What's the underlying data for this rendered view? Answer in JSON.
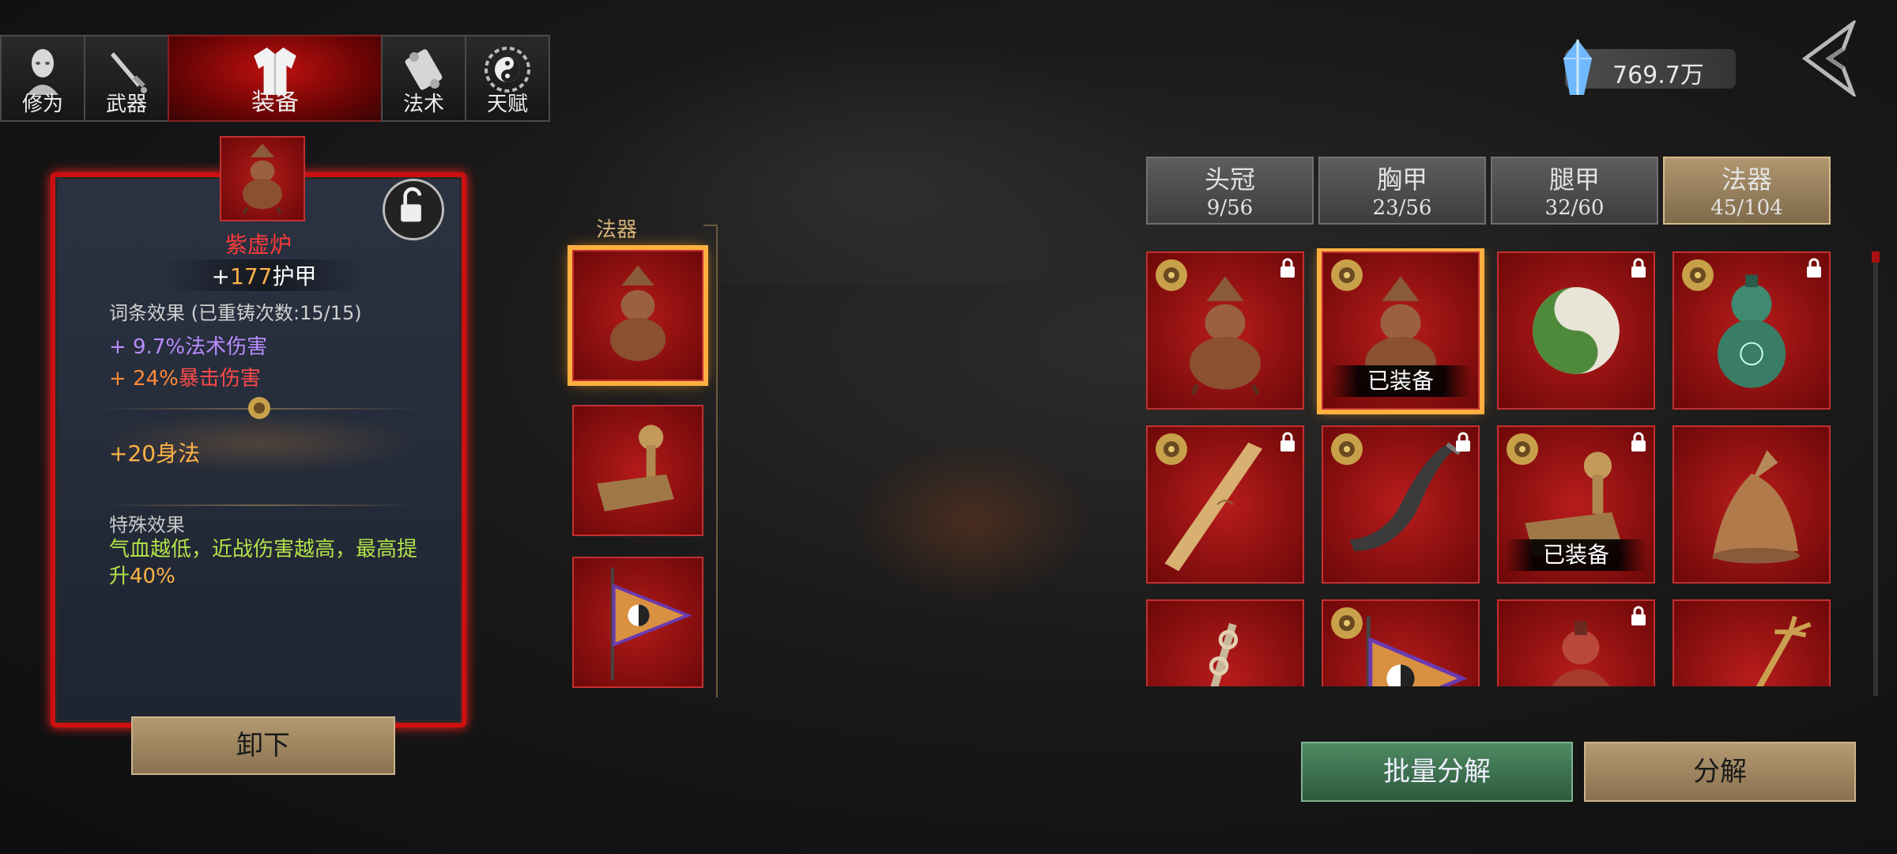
{
  "top_tabs": [
    {
      "label": "修为",
      "icon": "monk-head-icon",
      "active": false
    },
    {
      "label": "武器",
      "icon": "sword-icon",
      "active": false
    },
    {
      "label": "装备",
      "icon": "robe-icon",
      "active": true
    },
    {
      "label": "法术",
      "icon": "scroll-icon",
      "active": false
    },
    {
      "label": "天赋",
      "icon": "yin-yang-icon",
      "active": false
    }
  ],
  "currency": {
    "value": "769.7万",
    "icon": "spirit-crystal-icon"
  },
  "detail": {
    "name": "紫虚炉",
    "armor_prefix": "+",
    "armor_value": "177",
    "armor_label": "护甲",
    "affix_title": "词条效果",
    "reforge_note": "(已重铸次数:15/15)",
    "affix_1_value": "+ 9.7%",
    "affix_1_label": "法术伤害",
    "affix_2_value": "+ 24%",
    "affix_2_label": "暴击伤害",
    "bonus_prefix": "+",
    "bonus_value": "20",
    "bonus_label": "身法",
    "special_title": "特殊效果",
    "special_text_1": "气血越低，近战伤害越高，最高提升",
    "special_value": "40%",
    "unequip_label": "卸下"
  },
  "slot_column": {
    "heading": "法器",
    "slots": [
      {
        "item": "gourd-censer-icon",
        "selected": true
      },
      {
        "item": "seal-stamp-icon",
        "selected": false
      },
      {
        "item": "bagua-banner-icon",
        "selected": false
      }
    ]
  },
  "categories": [
    {
      "title": "头冠",
      "count": "9/56",
      "active": false
    },
    {
      "title": "胸甲",
      "count": "23/56",
      "active": false
    },
    {
      "title": "腿甲",
      "count": "32/60",
      "active": false
    },
    {
      "title": "法器",
      "count": "45/104",
      "active": true
    }
  ],
  "equipped_label": "已装备",
  "grid_items": [
    {
      "item": "gourd-censer-icon",
      "coin": true,
      "locked": true,
      "equipped": false,
      "selected": false
    },
    {
      "item": "gourd-censer-icon",
      "coin": true,
      "locked": false,
      "equipped": true,
      "selected": true
    },
    {
      "item": "yin-yang-jade-icon",
      "coin": false,
      "locked": true,
      "equipped": false,
      "selected": false
    },
    {
      "item": "green-gourd-icon",
      "coin": true,
      "locked": true,
      "equipped": false,
      "selected": false
    },
    {
      "item": "wooden-ruler-icon",
      "coin": true,
      "locked": true,
      "equipped": false,
      "selected": false
    },
    {
      "item": "horn-icon",
      "coin": true,
      "locked": true,
      "equipped": false,
      "selected": false
    },
    {
      "item": "seal-stamp-icon",
      "coin": true,
      "locked": true,
      "equipped": true,
      "selected": false
    },
    {
      "item": "bronze-bell-icon",
      "coin": false,
      "locked": false,
      "equipped": false,
      "selected": false
    },
    {
      "item": "knotted-sword-icon",
      "coin": false,
      "locked": false,
      "equipped": false,
      "selected": false
    },
    {
      "item": "bagua-banner-icon",
      "coin": true,
      "locked": false,
      "equipped": false,
      "selected": false
    },
    {
      "item": "red-gourd-icon",
      "coin": false,
      "locked": true,
      "equipped": false,
      "selected": false
    },
    {
      "item": "trident-icon",
      "coin": false,
      "locked": false,
      "equipped": false,
      "selected": false
    }
  ],
  "buttons": {
    "batch_decompose": "批量分解",
    "decompose": "分解"
  },
  "colors": {
    "accent_red": "#c01010",
    "gold": "#ffb040",
    "green_text": "#b3e34a",
    "purple_text": "#b98cff"
  }
}
